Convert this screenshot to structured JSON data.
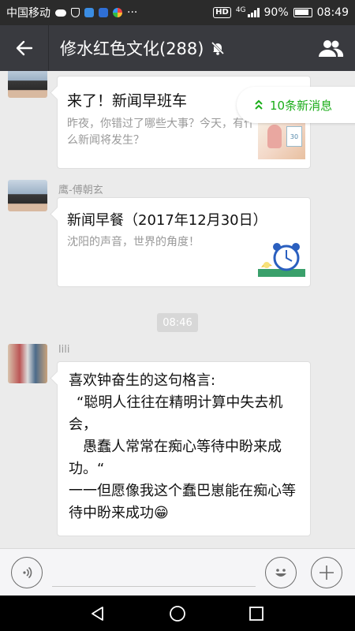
{
  "status_bar": {
    "carrier": "中国移动",
    "network": "4G",
    "battery": "90%",
    "time": "08:49",
    "more": "···"
  },
  "header": {
    "title": "修水红色文化(288)",
    "back_icon": "back-arrow-icon",
    "mute_icon": "bell-muted-icon",
    "members_icon": "group-members-icon"
  },
  "new_messages": {
    "label": "10条新消息",
    "icon": "double-chevron-up-icon"
  },
  "messages": [
    {
      "sender": "鹰-傅朝玄",
      "type": "card",
      "title": "来了！新闻早班车",
      "description": "昨夜，你错过了哪些大事？今天，有什么新闻将发生？"
    },
    {
      "sender": "鹰-傅朝玄",
      "type": "card",
      "title": "新闻早餐（2017年12月30日）",
      "description": "沈阳的声音，世界的角度！"
    },
    {
      "type": "time",
      "text": "08:46"
    },
    {
      "sender": "lili",
      "type": "text",
      "lines": [
        "喜欢钟奋生的这句格言:",
        "“聪明人往往在精明计算中失去机会，",
        "愚蠢人常常在痴心等待中盼来成功。“",
        "一一但愿像我这个蠢巴崽能在痴心等待中盼来成功😁"
      ]
    }
  ],
  "input_bar": {
    "voice_icon": "voice-icon",
    "emoji_icon": "emoji-icon",
    "plus_icon": "plus-icon"
  },
  "nav_bar": {
    "back_icon": "nav-back-icon",
    "home_icon": "nav-home-icon",
    "recents_icon": "nav-recents-icon"
  },
  "colors": {
    "title_bar": "#393a3f",
    "status_bar": "#2b2b2b",
    "accent_green": "#1aad19",
    "chat_bg": "#ebebeb"
  }
}
